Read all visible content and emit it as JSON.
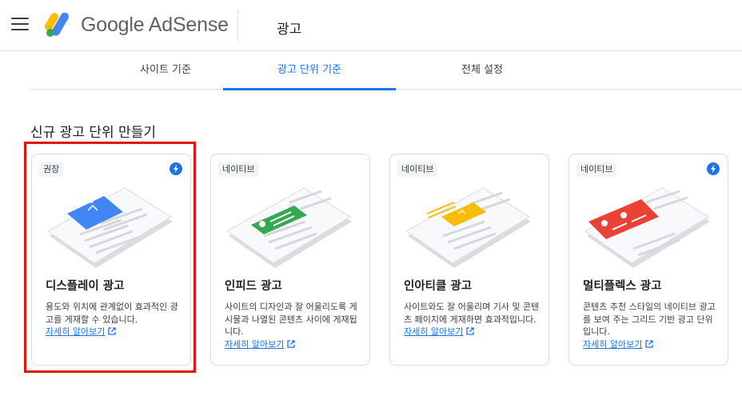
{
  "header": {
    "brand": "Google AdSense",
    "page_title": "광고"
  },
  "tabs": [
    {
      "label": "사이트 기준",
      "active": false
    },
    {
      "label": "광고 단위 기준",
      "active": true
    },
    {
      "label": "전체 설정",
      "active": false
    }
  ],
  "section_title": "신규 광고 단위 만들기",
  "learn_more": "자세히 알아보기",
  "cards": [
    {
      "badge": "권장",
      "title": "디스플레이 광고",
      "desc": "용도와 위치에 관계없이 효과적인 광고를 게재할 수 있습니다.",
      "shape_color": "#4285f4",
      "has_bolt": true,
      "selected": true
    },
    {
      "badge": "네이티브",
      "title": "인피드 광고",
      "desc": "사이트의 디자인과 잘 어울리도록 게시물과 나열된 콘텐츠 사이에 게재됩니다.",
      "shape_color": "#34a853",
      "has_bolt": false,
      "selected": false
    },
    {
      "badge": "네이티브",
      "title": "인아티클 광고",
      "desc": "사이트와도 잘 어울리며 기사 및 콘텐츠 페이지에 게재하면 효과적입니다.",
      "shape_color": "#fbbc04",
      "has_bolt": false,
      "selected": false
    },
    {
      "badge": "네이티브",
      "title": "멀티플렉스 광고",
      "desc": "콘텐츠 추천 스타일의 네이티브 광고를 보여 주는 그리드 기반 광고 단위입니다.",
      "shape_color": "#ea4335",
      "has_bolt": true,
      "selected": false
    }
  ],
  "colors": {
    "accent": "#1a73e8",
    "selection_outline": "#e01414",
    "bolt": "#1a73e8"
  },
  "icons": {
    "menu": "menu-icon",
    "bolt": "bolt-icon",
    "external_link": "open-in-new-icon"
  }
}
